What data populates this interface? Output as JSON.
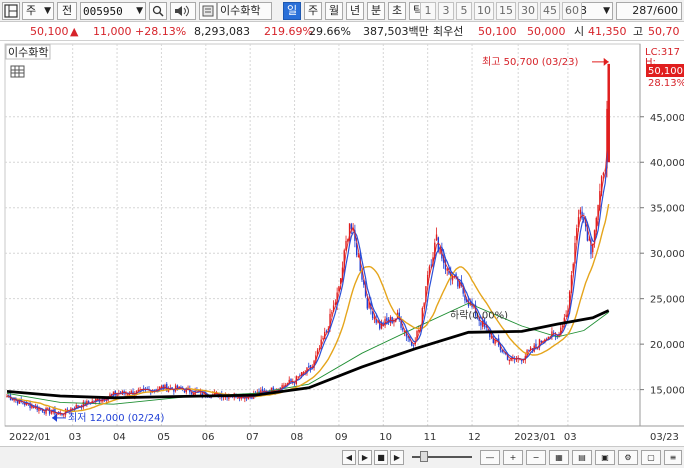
{
  "toolbar": {
    "type_label": "주",
    "jeon_label": "전",
    "code": "005950",
    "stock_name": "이수화학",
    "period_tabs": [
      {
        "label": "일",
        "active": true
      },
      {
        "label": "주",
        "active": false
      },
      {
        "label": "월",
        "active": false
      },
      {
        "label": "년",
        "active": false
      },
      {
        "label": "분",
        "active": false
      },
      {
        "label": "초",
        "active": false
      },
      {
        "label": "틱",
        "active": false
      }
    ],
    "intervals": [
      "1",
      "3",
      "5",
      "10",
      "15",
      "30",
      "45",
      "60"
    ],
    "custom_interval": "3",
    "bar_count": "287",
    "bar_total": "/600",
    "icons": [
      "layout-icon",
      "search-icon",
      "speaker-icon",
      "search-mode-icon",
      "settings-icon"
    ]
  },
  "quote": {
    "price": "50,100",
    "change": "11,000",
    "change_pct": "+28.13%",
    "volume": "8,293,083",
    "vol_ratio": "219.69%",
    "turnover": "29.66%",
    "amount": "387,503백만",
    "lv_label": "최우선",
    "ask": "50,100",
    "bid": "50,000",
    "open_label": "시",
    "open": "41,350",
    "high_label": "고",
    "high": "50,70"
  },
  "chart": {
    "title": "이수화학",
    "max_label": "최고 50,700 (03/23)",
    "min_label": "최저 12,000 (02/24)",
    "lc_label": "LC:317",
    "hi_label": "H:",
    "price_tag": "50,100",
    "price_tag_pct": "28.13%",
    "annotation": "하락(0.00%)",
    "colors": {
      "up": "#e01e1e",
      "down": "#1f3fd6",
      "ma5": "#e01e1e",
      "ma20": "#2a4fd8",
      "ma60": "#e5a51c",
      "ma120": "#1f8f33",
      "ma240": "#000000"
    }
  },
  "chart_data": {
    "type": "candlestick",
    "ylim": [
      11000,
      53000
    ],
    "yticks": [
      15000,
      20000,
      25000,
      30000,
      35000,
      40000,
      45000
    ],
    "ytick_labels": [
      "15,000",
      "20,000",
      "25,000",
      "30,000",
      "35,000",
      "40,000",
      "45,000"
    ],
    "xticks": [
      "2022/01",
      "03",
      "04",
      "05",
      "06",
      "07",
      "08",
      "09",
      "10",
      "11",
      "12",
      "2023/01",
      "03",
      "03/23"
    ],
    "xtick_index": [
      0,
      37,
      62,
      87,
      112,
      137,
      162,
      187,
      212,
      237,
      262,
      288,
      316,
      348
    ],
    "key_closes": [
      [
        0,
        14300
      ],
      [
        8,
        13600
      ],
      [
        20,
        12800
      ],
      [
        30,
        12300
      ],
      [
        37,
        13000
      ],
      [
        50,
        13800
      ],
      [
        62,
        14600
      ],
      [
        75,
        14700
      ],
      [
        87,
        15200
      ],
      [
        100,
        15000
      ],
      [
        112,
        14500
      ],
      [
        125,
        14400
      ],
      [
        137,
        14300
      ],
      [
        150,
        15000
      ],
      [
        162,
        16000
      ],
      [
        172,
        17500
      ],
      [
        180,
        21500
      ],
      [
        187,
        26000
      ],
      [
        193,
        33500
      ],
      [
        198,
        29500
      ],
      [
        203,
        24500
      ],
      [
        210,
        22000
      ],
      [
        220,
        23000
      ],
      [
        228,
        20000
      ],
      [
        233,
        22000
      ],
      [
        237,
        28000
      ],
      [
        242,
        31500
      ],
      [
        248,
        28000
      ],
      [
        256,
        26000
      ],
      [
        262,
        24000
      ],
      [
        270,
        21500
      ],
      [
        278,
        19500
      ],
      [
        284,
        18200
      ],
      [
        290,
        18500
      ],
      [
        297,
        19500
      ],
      [
        304,
        21000
      ],
      [
        310,
        20800
      ],
      [
        316,
        24000
      ],
      [
        320,
        31000
      ],
      [
        323,
        35500
      ],
      [
        326,
        33000
      ],
      [
        329,
        30500
      ],
      [
        332,
        34000
      ],
      [
        334,
        36000
      ],
      [
        336,
        39500
      ],
      [
        337,
        40100
      ],
      [
        339,
        50100
      ]
    ],
    "ma240_points": [
      [
        0,
        14800
      ],
      [
        30,
        14300
      ],
      [
        60,
        14100
      ],
      [
        100,
        14250
      ],
      [
        140,
        14400
      ],
      [
        170,
        15200
      ],
      [
        200,
        17500
      ],
      [
        230,
        19500
      ],
      [
        260,
        21300
      ],
      [
        290,
        21400
      ],
      [
        310,
        22200
      ],
      [
        330,
        22900
      ],
      [
        339,
        23700
      ]
    ],
    "ma120_points": [
      [
        0,
        14600
      ],
      [
        30,
        13600
      ],
      [
        60,
        13400
      ],
      [
        100,
        14200
      ],
      [
        140,
        14600
      ],
      [
        170,
        15600
      ],
      [
        200,
        19000
      ],
      [
        230,
        21800
      ],
      [
        260,
        24500
      ],
      [
        290,
        22000
      ],
      [
        310,
        20800
      ],
      [
        325,
        21500
      ],
      [
        339,
        23500
      ]
    ]
  }
}
